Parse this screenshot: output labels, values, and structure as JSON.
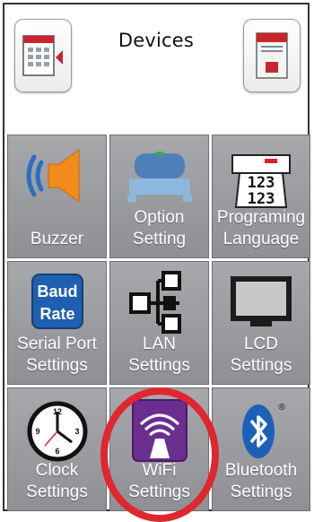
{
  "header": {
    "title": "Devices",
    "left_icon": "printer-keypad-icon",
    "right_icon": "printer-icon"
  },
  "tiles": [
    {
      "name": "buzzer",
      "icon": "speaker-icon",
      "label_lines": [
        "",
        "Buzzer"
      ]
    },
    {
      "name": "option-setting",
      "icon": "printer-option-icon",
      "label_lines": [
        "Option",
        "Setting"
      ]
    },
    {
      "name": "programing-language",
      "icon": "print-language-icon",
      "label_lines": [
        "Programing",
        "Language"
      ],
      "icon_text": "123"
    },
    {
      "name": "serial-port-settings",
      "icon": "baud-rate-icon",
      "label_lines": [
        "Serial Port",
        "Settings"
      ],
      "icon_text": [
        "Baud",
        "Rate"
      ]
    },
    {
      "name": "lan-settings",
      "icon": "network-icon",
      "label_lines": [
        "LAN",
        "Settings"
      ]
    },
    {
      "name": "lcd-settings",
      "icon": "monitor-icon",
      "label_lines": [
        "LCD",
        "Settings"
      ]
    },
    {
      "name": "clock-settings",
      "icon": "clock-icon",
      "label_lines": [
        "Clock",
        "Settings"
      ],
      "icon_text": [
        "12",
        "3",
        "6",
        "9"
      ]
    },
    {
      "name": "wifi-settings",
      "icon": "wifi-icon",
      "label_lines": [
        "WiFi",
        "Settings"
      ]
    },
    {
      "name": "bluetooth-settings",
      "icon": "bluetooth-icon",
      "label_lines": [
        "Bluetooth",
        "Settings"
      ],
      "icon_text": "®"
    }
  ],
  "highlight": {
    "target": "wifi-settings",
    "color": "#e0262e"
  }
}
